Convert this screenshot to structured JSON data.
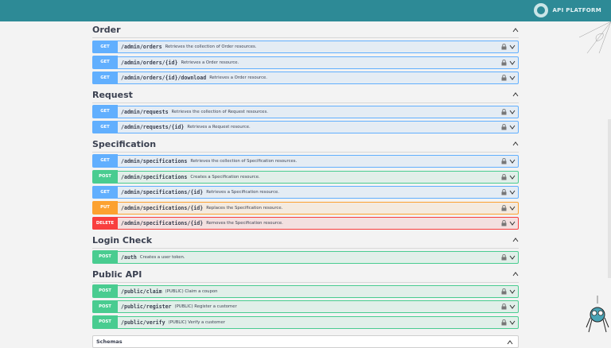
{
  "header": {
    "logo_text": "API PLATFORM"
  },
  "colors": {
    "GET": "#61affe",
    "POST": "#49cc90",
    "PUT": "#fca130",
    "DELETE": "#f93e3e"
  },
  "sections": [
    {
      "title": "Order",
      "ops": [
        {
          "method": "GET",
          "path": "/admin/orders",
          "desc": "Retrieves the collection of Order resources."
        },
        {
          "method": "GET",
          "path": "/admin/orders/{id}",
          "desc": "Retrieves a Order resource."
        },
        {
          "method": "GET",
          "path": "/admin/orders/{id}/download",
          "desc": "Retrieves a Order resource."
        }
      ]
    },
    {
      "title": "Request",
      "ops": [
        {
          "method": "GET",
          "path": "/admin/requests",
          "desc": "Retrieves the collection of Request resources."
        },
        {
          "method": "GET",
          "path": "/admin/requests/{id}",
          "desc": "Retrieves a Request resource."
        }
      ]
    },
    {
      "title": "Specification",
      "ops": [
        {
          "method": "GET",
          "path": "/admin/specifications",
          "desc": "Retrieves the collection of Specification resources."
        },
        {
          "method": "POST",
          "path": "/admin/specifications",
          "desc": "Creates a Specification resource."
        },
        {
          "method": "GET",
          "path": "/admin/specifications/{id}",
          "desc": "Retrieves a Specification resource."
        },
        {
          "method": "PUT",
          "path": "/admin/specifications/{id}",
          "desc": "Replaces the Specification resource."
        },
        {
          "method": "DELETE",
          "path": "/admin/specifications/{id}",
          "desc": "Removes the Specification resource."
        }
      ]
    },
    {
      "title": "Login Check",
      "ops": [
        {
          "method": "POST",
          "path": "/auth",
          "desc": "Creates a user token."
        }
      ]
    },
    {
      "title": "Public API",
      "ops": [
        {
          "method": "POST",
          "path": "/public/claim",
          "desc": "(PUBLIC) Claim a coupon"
        },
        {
          "method": "POST",
          "path": "/public/register",
          "desc": "(PUBLIC) Register a customer"
        },
        {
          "method": "POST",
          "path": "/public/verify",
          "desc": "(PUBLIC) Verify a customer"
        }
      ]
    }
  ],
  "schemas": {
    "title": "Schemas"
  }
}
